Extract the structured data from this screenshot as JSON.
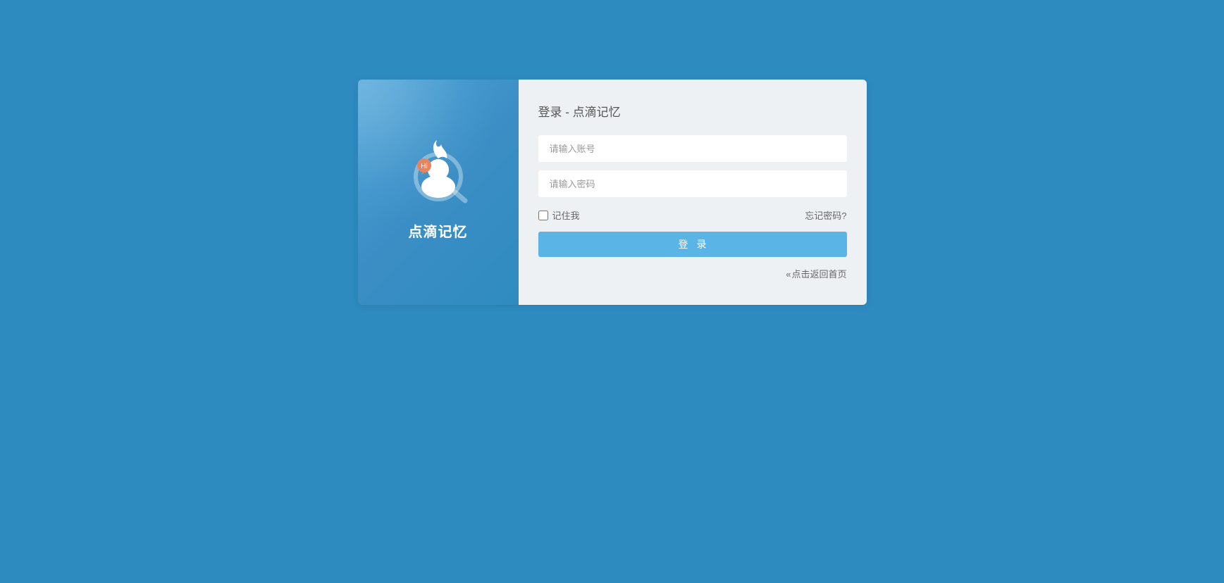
{
  "brand": {
    "name": "点滴记忆",
    "hi_badge_text": "Hi"
  },
  "form": {
    "title": "登录 - 点滴记忆",
    "username_placeholder": "请输入账号",
    "password_placeholder": "请输入密码",
    "remember_label": "记住我",
    "forgot_label": "忘记密码?",
    "login_button_label": "登录",
    "back_link_arrows": "«",
    "back_link_label": "点击返回首页"
  },
  "colors": {
    "page_bg": "#2E8BC0",
    "panel_bg": "#EDF1F4",
    "accent": "#5AB4E5",
    "hi_badge": "#E7835F"
  }
}
